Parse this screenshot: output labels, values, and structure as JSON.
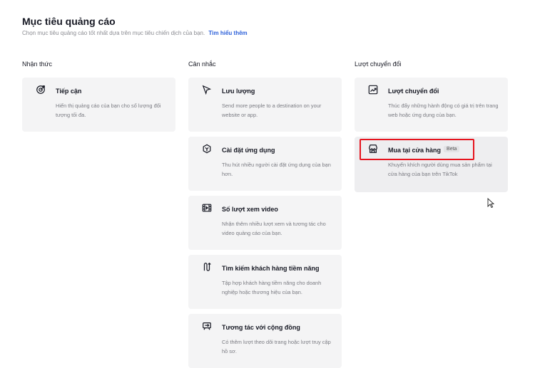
{
  "header": {
    "title": "Mục tiêu quảng cáo",
    "subtitle": "Chọn mục tiêu quảng cáo tốt nhất dựa trên mục tiêu chiến dịch của bạn.",
    "link": "Tìm hiểu thêm"
  },
  "columns": [
    {
      "heading": "Nhận thức",
      "cards": [
        {
          "icon": "target-icon",
          "title": "Tiếp cận",
          "desc": "Hiển thị quảng cáo của bạn cho số lượng đối tượng tối đa."
        }
      ]
    },
    {
      "heading": "Cân nhắc",
      "cards": [
        {
          "icon": "cursor-arrow-icon",
          "title": "Lưu lượng",
          "desc": "Send more people to a destination on your website or app."
        },
        {
          "icon": "app-install-icon",
          "title": "Cài đặt ứng dụng",
          "desc": "Thu hút nhiều người cài đặt ứng dụng của bạn hơn."
        },
        {
          "icon": "video-film-icon",
          "title": "Số lượt xem video",
          "desc": "Nhận thêm nhiều lượt xem và tương tác cho video quảng cáo của bạn."
        },
        {
          "icon": "lead-generation-icon",
          "title": "Tìm kiếm khách hàng tiềm năng",
          "desc": "Tập hợp khách hàng tiềm năng cho doanh nghiệp hoặc thương hiệu của bạn."
        },
        {
          "icon": "community-interaction-icon",
          "title": "Tương tác với cộng đồng",
          "desc": "Có thêm lượt theo dõi trang hoặc lượt truy cập hồ sơ."
        }
      ]
    },
    {
      "heading": "Lượt chuyển đổi",
      "cards": [
        {
          "icon": "conversion-chart-icon",
          "title": "Lượt chuyển đổi",
          "desc": "Thúc đẩy những hành động có giá trị trên trang web hoặc ứng dụng của bạn."
        },
        {
          "icon": "store-icon",
          "title": "Mua tại cửa hàng",
          "badge": "Beta",
          "desc": "Khuyến khích người dùng mua sản phẩm tại cửa hàng của bạn trên TikTok"
        }
      ]
    }
  ]
}
